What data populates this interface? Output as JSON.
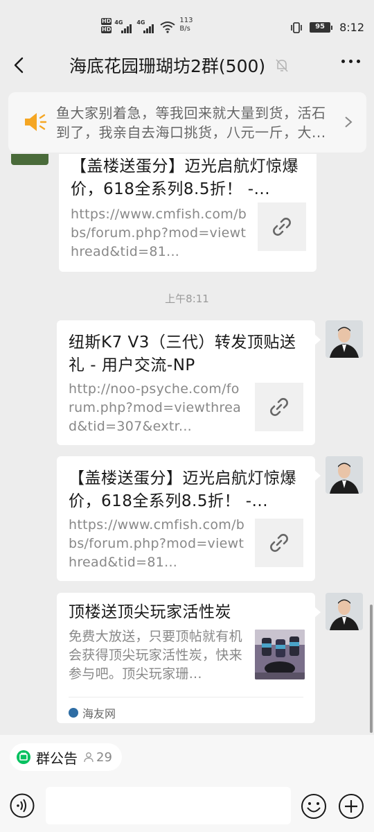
{
  "status": {
    "hd1": "HD",
    "hd2": "HD",
    "net1": "4G",
    "net2": "4G",
    "speed_value": "113",
    "speed_unit": "B/s",
    "battery": "95",
    "time": "8:12"
  },
  "header": {
    "title": "海底花园珊瑚坊2群(500)"
  },
  "notice": {
    "text": "鱼大家别着急，等我回来就大量到货，活石到了，我亲自去海口挑货，八元一斤，大..."
  },
  "messages": [
    {
      "title": "【盖楼送蛋分】迈光启航灯惊爆价，618全系列8.5折！ -...",
      "desc": "https://www.cmfish.com/bbs/forum.php?mod=viewthread&tid=81..."
    },
    {
      "title": "纽斯K7 V3（三代）转发顶贴送礼 - 用户交流-NP",
      "desc": "http://noo-psyche.com/forum.php?mod=viewthread&tid=307&extr..."
    },
    {
      "title": "【盖楼送蛋分】迈光启航灯惊爆价，618全系列8.5折！ -...",
      "desc": "https://www.cmfish.com/bbs/forum.php?mod=viewthread&tid=81..."
    },
    {
      "title": "顶楼送顶尖玩家活性炭",
      "desc": "免费大放送，只要顶帖就有机会获得顶尖玩家活性炭，快来参与吧。顶尖玩家珊...",
      "source": "海友网"
    }
  ],
  "timestamp": "上午8:11",
  "bottom": {
    "notice_label": "群公告",
    "member_count": "29"
  },
  "icons": {
    "back": "chevron-left-icon",
    "mute": "bell-off-icon",
    "more": "more-dots-icon",
    "speaker": "speaker-icon",
    "link": "link-icon",
    "voice": "voice-icon",
    "emoji": "emoji-icon",
    "plus": "plus-icon"
  }
}
